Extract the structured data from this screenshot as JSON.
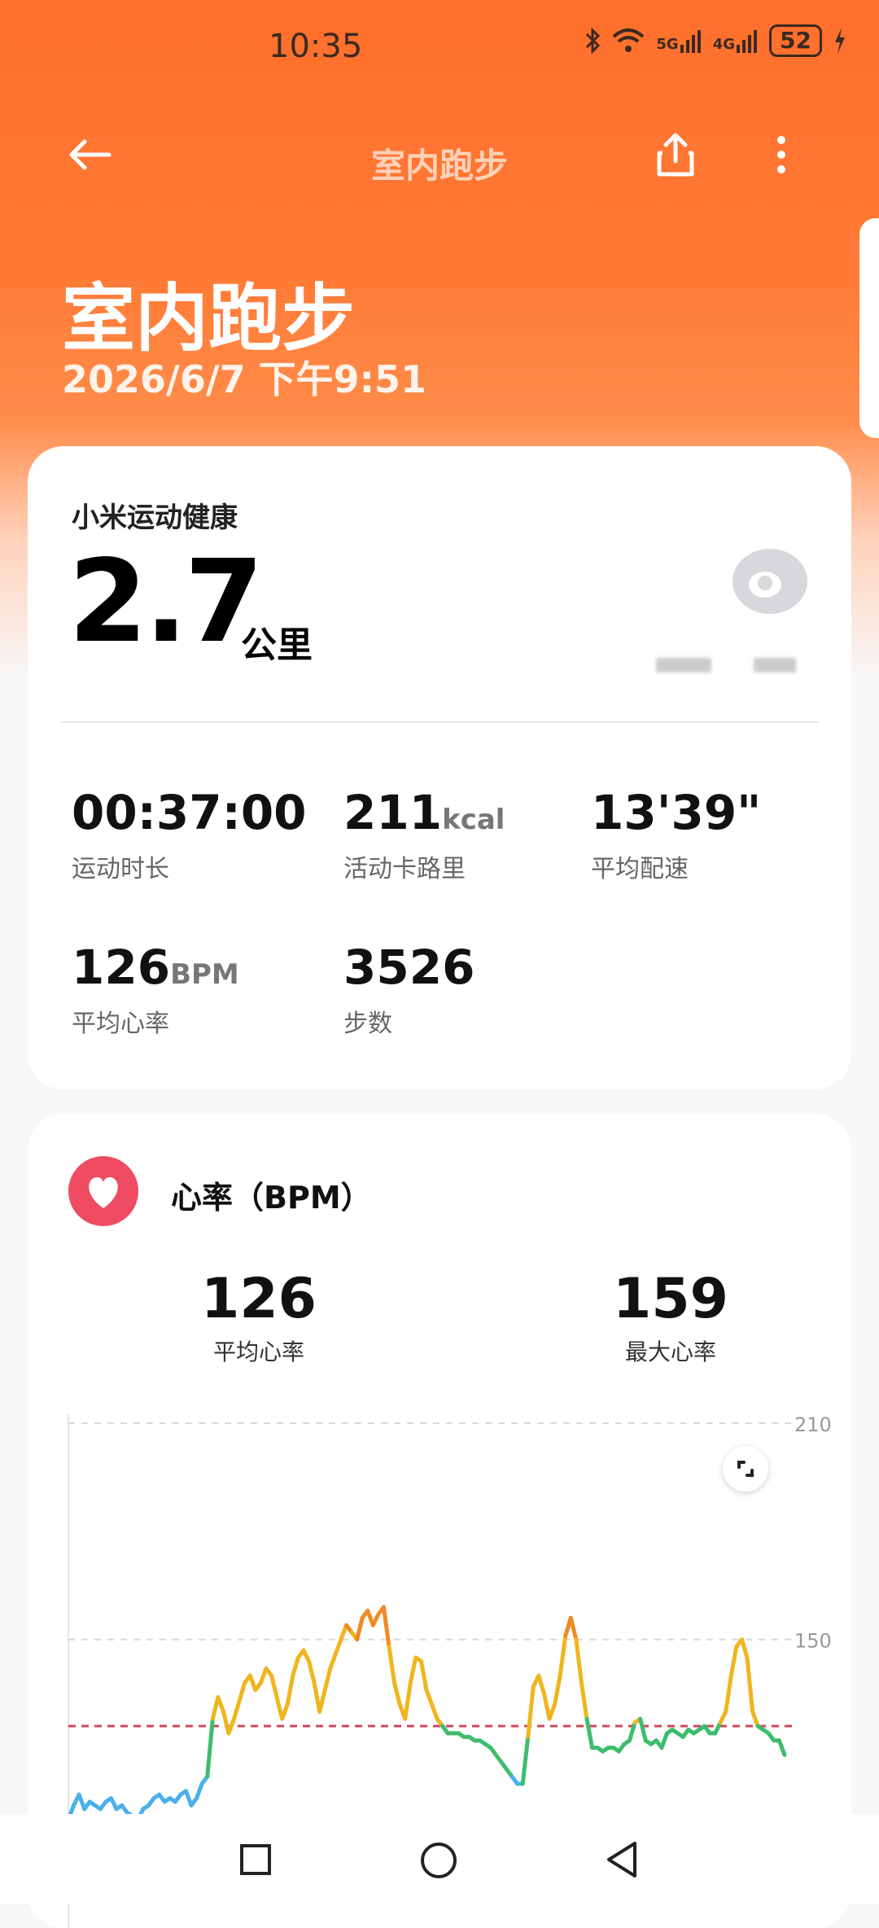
{
  "status_bar": {
    "time": "10:35",
    "network_5g": "5G",
    "network_4g": "4G",
    "battery": "52",
    "icons": [
      "bluetooth-icon",
      "wifi-icon",
      "signal-5g-icon",
      "signal-4g-icon",
      "battery-icon",
      "charging-icon"
    ]
  },
  "app_bar": {
    "title": "室内跑步",
    "icons": [
      "back-arrow-icon",
      "share-icon",
      "more-vertical-icon"
    ]
  },
  "hero": {
    "title": "室内跑步",
    "datetime": "2026/6/7 下午9:51"
  },
  "summary": {
    "source": "小米运动健康",
    "distance": "2.7",
    "distance_unit": "公里",
    "metrics": [
      {
        "value": "00:37:00",
        "unit": "",
        "label": "运动时长"
      },
      {
        "value": "211",
        "unit": "kcal",
        "label": "活动卡路里"
      },
      {
        "value": "13'39\"",
        "unit": "",
        "label": "平均配速"
      },
      {
        "value": "126",
        "unit": "BPM",
        "label": "平均心率"
      },
      {
        "value": "3526",
        "unit": "",
        "label": "步数"
      }
    ]
  },
  "heart_rate": {
    "title": "心率（BPM）",
    "avg_value": "126",
    "avg_label": "平均心率",
    "max_value": "159",
    "max_label": "最大心率"
  },
  "chart_data": {
    "type": "line",
    "title": "",
    "xlabel": "",
    "ylabel": "",
    "ylim": [
      70,
      210
    ],
    "yticks": [
      90,
      150,
      210
    ],
    "grid": true,
    "reference_line": 126,
    "zone_colors": {
      "low": "#4ab0ea",
      "mid": "#3dbd6c",
      "high": "#f0b51e",
      "peak": "#f08a24"
    },
    "values": [
      100,
      104,
      107,
      103,
      105,
      104,
      103,
      105,
      106,
      103,
      104,
      102,
      101,
      100,
      103,
      104,
      106,
      107,
      105,
      106,
      105,
      107,
      108,
      104,
      106,
      110,
      112,
      128,
      134,
      130,
      124,
      128,
      133,
      138,
      140,
      136,
      138,
      142,
      140,
      134,
      128,
      132,
      140,
      145,
      147,
      144,
      138,
      130,
      136,
      142,
      146,
      150,
      154,
      152,
      150,
      156,
      158,
      154,
      157,
      159,
      148,
      138,
      132,
      128,
      138,
      145,
      144,
      136,
      132,
      128,
      126,
      124,
      124,
      124,
      123,
      123,
      122,
      122,
      121,
      120,
      118,
      116,
      114,
      112,
      110,
      110,
      123,
      137,
      140,
      135,
      128,
      132,
      140,
      151,
      156,
      150,
      138,
      128,
      120,
      120,
      119,
      120,
      120,
      119,
      121,
      122,
      127,
      128,
      122,
      121,
      122,
      120,
      124,
      125,
      124,
      123,
      125,
      124,
      125,
      126,
      124,
      124,
      127,
      130,
      140,
      148,
      150,
      145,
      130,
      126,
      125,
      124,
      122,
      122,
      118
    ]
  },
  "nav_bar": {
    "icons": [
      "recent-apps-icon",
      "home-icon",
      "back-icon"
    ]
  }
}
